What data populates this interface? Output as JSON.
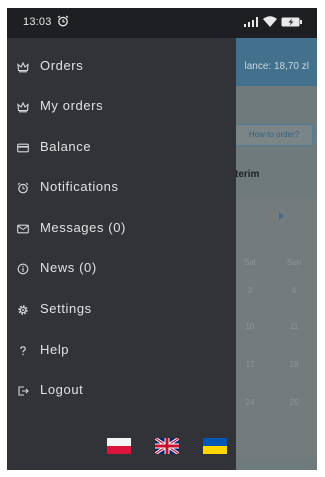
{
  "status_bar": {
    "time": "13:03",
    "icons": [
      "alarm-icon",
      "signal-icon",
      "wifi-icon",
      "battery-icon"
    ]
  },
  "app": {
    "balance_text": "lance: 18,70 zl",
    "how_to_order": "How to order?",
    "term_label": "terim",
    "calendar": {
      "headers": [
        "Sat",
        "Sun"
      ],
      "rows": [
        [
          "3",
          "4"
        ],
        [
          "10",
          "11"
        ],
        [
          "17",
          "18"
        ],
        [
          "24",
          "25"
        ]
      ]
    }
  },
  "drawer": {
    "items": [
      {
        "label": "Orders",
        "icon": "crown-icon"
      },
      {
        "label": "My orders",
        "icon": "crown-icon"
      },
      {
        "label": "Balance",
        "icon": "card-icon"
      },
      {
        "label": "Notifications",
        "icon": "alarm-icon"
      },
      {
        "label": "Messages (0)",
        "icon": "mail-icon"
      },
      {
        "label": "News (0)",
        "icon": "info-icon"
      },
      {
        "label": "Settings",
        "icon": "gear-icon"
      },
      {
        "label": "Help",
        "icon": "question-icon"
      },
      {
        "label": "Logout",
        "icon": "logout-icon"
      }
    ],
    "languages": [
      "polish-flag",
      "uk-flag",
      "ukraine-flag"
    ]
  },
  "colors": {
    "drawer_bg": "#313338",
    "status_bar_bg": "#1e1f23",
    "app_header": "#43708c",
    "menu_text": "#e2e2e2"
  }
}
